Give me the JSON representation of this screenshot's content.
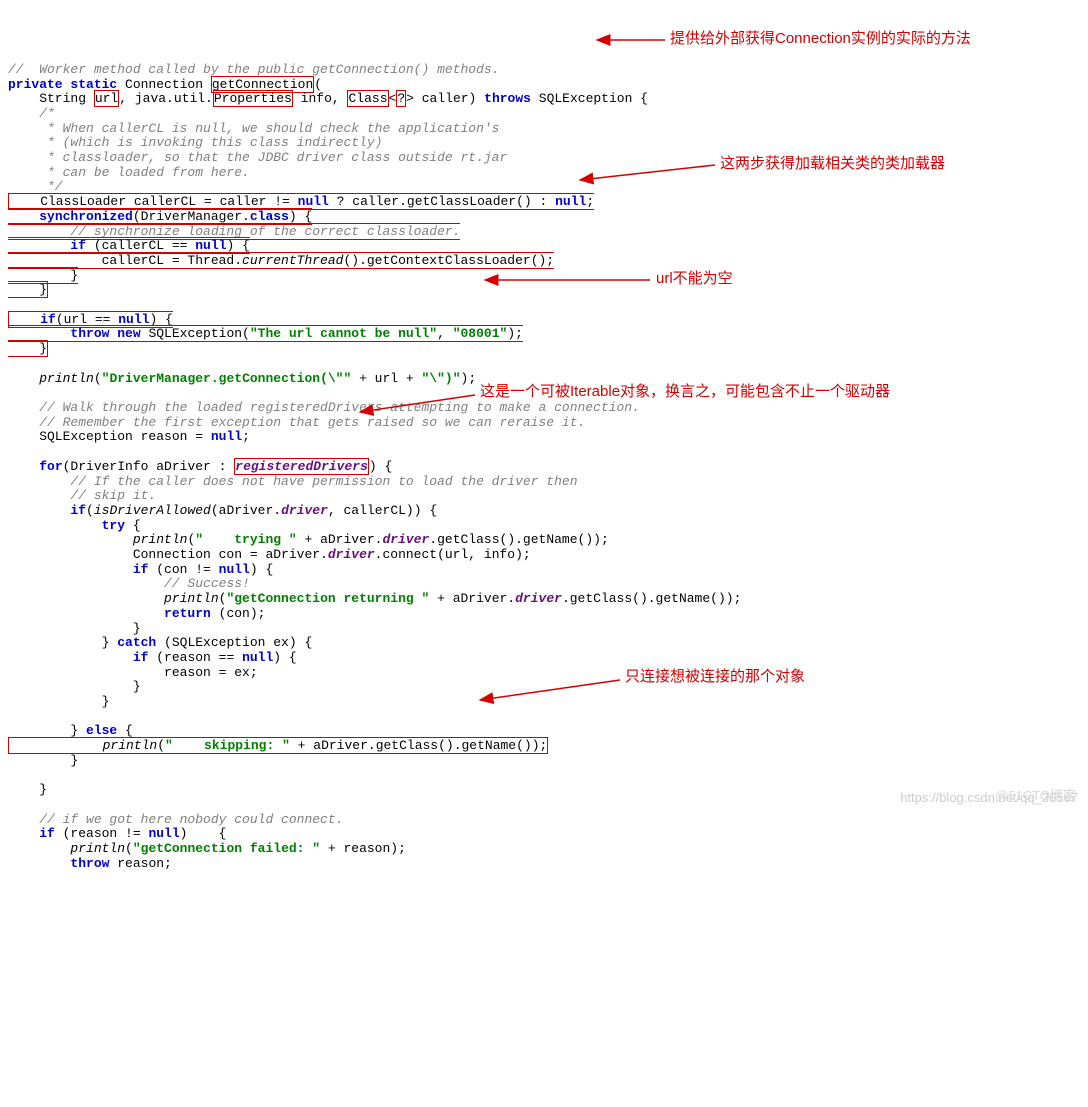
{
  "code": {
    "l1": "//  Worker method called by the public getConnection() methods.",
    "l2a": "private static",
    "l2b": " Connection ",
    "l2c": "getConnection",
    "l2d": "(",
    "l3a": "    String ",
    "l3b": "url",
    "l3c": ", java.util.",
    "l3d": "Properties",
    "l3e": " info, ",
    "l3f": "Class",
    "l3g": "<",
    "l3h": "?",
    "l3i": ">",
    "l3j": " caller) ",
    "l3k": "throws",
    "l3l": " SQLException {",
    "l4": "    /*",
    "l5": "     * When callerCL is null, we should check the application's",
    "l6": "     * (which is invoking this class indirectly)",
    "l7": "     * classloader, so that the JDBC driver class outside rt.jar",
    "l8": "     * can be loaded from here.",
    "l9": "     */",
    "b1l1a": "    ClassLoader callerCL = caller != ",
    "b1l1b": "null",
    "b1l1c": " ? caller.getClassLoader() : ",
    "b1l1d": "null",
    "b1l1e": ";",
    "b1l2a": "    ",
    "b1l2b": "synchronized",
    "b1l2c": "(DriverManager.",
    "b1l2d": "class",
    "b1l2e": ") {",
    "b1l3": "        // synchronize loading of the correct classloader.",
    "b1l4a": "        ",
    "b1l4b": "if",
    "b1l4c": " (callerCL == ",
    "b1l4d": "null",
    "b1l4e": ") {",
    "b1l5a": "            callerCL = Thread.",
    "b1l5b": "currentThread",
    "b1l5c": "().getContextClassLoader();",
    "b1l6": "        }",
    "b1l7": "    }",
    "blank1": "",
    "b2l1a": "    ",
    "b2l1b": "if",
    "b2l1c": "(url == ",
    "b2l1d": "null",
    "b2l1e": ") {",
    "b2l2a": "        ",
    "b2l2b": "throw new",
    "b2l2c": " SQLException(",
    "b2l2d": "\"The url cannot be null\"",
    "b2l2e": ", ",
    "b2l2f": "\"08001\"",
    "b2l2g": ");",
    "b2l3": "    }",
    "blank2": "",
    "pl1a": "    ",
    "pl1b": "println",
    "pl1c": "(",
    "pl1d": "\"DriverManager.getConnection(\\\"\"",
    "pl1e": " + url + ",
    "pl1f": "\"\\\")\"",
    "pl1g": ");",
    "blank3": "",
    "cm1": "    // Walk through the loaded registeredDrivers attempting to make a connection.",
    "cm2": "    // Remember the first exception that gets raised so we can reraise it.",
    "se1a": "    SQLException reason = ",
    "se1b": "null",
    "se1c": ";",
    "blank4": "",
    "fo1a": "    ",
    "fo1b": "for",
    "fo1c": "(DriverInfo aDriver : ",
    "fo1d": "registeredDrivers",
    "fo1e": ") {",
    "fc1": "        // If the caller does not have permission to load the driver then",
    "fc2": "        // skip it.",
    "if1a": "        ",
    "if1b": "if",
    "if1c": "(",
    "if1d": "isDriverAllowed",
    "if1e": "(aDriver.",
    "if1f": "driver",
    "if1g": ", callerCL)) {",
    "tr1a": "            ",
    "tr1b": "try",
    "tr1c": " {",
    "pr2a": "                ",
    "pr2b": "println",
    "pr2c": "(",
    "pr2d": "\"    trying \"",
    "pr2e": " + aDriver.",
    "pr2f": "driver",
    "pr2g": ".getClass().getName());",
    "co1a": "                Connection con = aDriver.",
    "co1b": "driver",
    "co1c": ".connect(url, info);",
    "if2a": "                ",
    "if2b": "if",
    "if2c": " (con != ",
    "if2d": "null",
    "if2e": ") {",
    "sc1": "                    // Success!",
    "pr3a": "                    ",
    "pr3b": "println",
    "pr3c": "(",
    "pr3d": "\"getConnection returning \"",
    "pr3e": " + aDriver.",
    "pr3f": "driver",
    "pr3g": ".getClass().getName());",
    "re1a": "                    ",
    "re1b": "return",
    "re1c": " (con);",
    "cb1": "                }",
    "ca1a": "            } ",
    "ca1b": "catch",
    "ca1c": " (SQLException ex) {",
    "if3a": "                ",
    "if3b": "if",
    "if3c": " (reason == ",
    "if3d": "null",
    "if3e": ") {",
    "as1": "                    reason = ex;",
    "cb2": "                }",
    "cb3": "            }",
    "blank5": "",
    "el1a": "        } ",
    "el1b": "else",
    "el1c": " {",
    "pr4a": "            ",
    "pr4b": "println",
    "pr4c": "(",
    "pr4d": "\"    skipping: \"",
    "pr4e": " + aDriver.getClass().getName());",
    "cb4": "        }",
    "blank6": "",
    "cb5": "    }",
    "blank7": "",
    "cm3": "    // if we got here nobody could connect.",
    "if4a": "    ",
    "if4b": "if",
    "if4c": " (reason != ",
    "if4d": "null",
    "if4e": ")    {",
    "pr5a": "        ",
    "pr5b": "println",
    "pr5c": "(",
    "pr5d": "\"getConnection failed: \"",
    "pr5e": " + reason);",
    "th1a": "        ",
    "th1b": "throw",
    "th1c": " reason;"
  },
  "annotations": {
    "a1": "提供给外部获得Connection实例的实际的方法",
    "a2": "这两步获得加载相关类的类加载器",
    "a3": "url不能为空",
    "a4": "这是一个可被Iterable对象，换言之，可能包含不止一个驱动器",
    "a5": "只连接想被连接的那个对象"
  },
  "watermark": "https://blog.csdn.net/qq_36567",
  "watermark2": "@51CTO博客"
}
